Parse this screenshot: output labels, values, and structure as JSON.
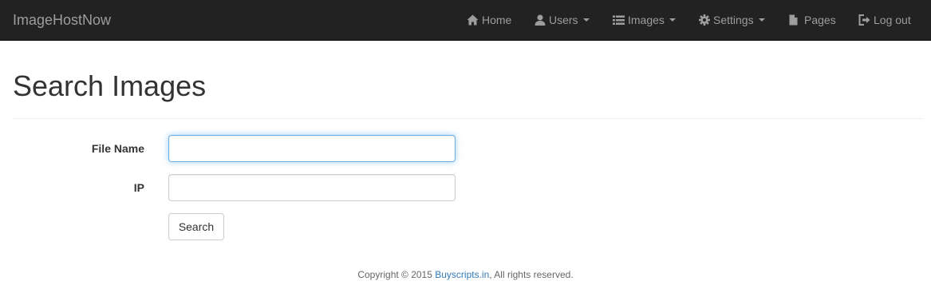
{
  "navbar": {
    "brand": "ImageHostNow",
    "items": [
      {
        "label": "Home",
        "icon": "home-icon",
        "dropdown": false
      },
      {
        "label": "Users",
        "icon": "user-icon",
        "dropdown": true
      },
      {
        "label": "Images",
        "icon": "list-icon",
        "dropdown": true
      },
      {
        "label": "Settings",
        "icon": "gear-icon",
        "dropdown": true
      },
      {
        "label": "Pages",
        "icon": "file-icon",
        "dropdown": false
      },
      {
        "label": "Log out",
        "icon": "logout-icon",
        "dropdown": false
      }
    ]
  },
  "page": {
    "title": "Search Images"
  },
  "form": {
    "file_name_label": "File Name",
    "file_name_value": "",
    "ip_label": "IP",
    "ip_value": "",
    "search_button": "Search"
  },
  "footer": {
    "prefix": "Copyright © 2015 ",
    "link": "Buyscripts.in",
    "suffix": ", All rights reserved."
  },
  "colors": {
    "navbar_bg": "#222222",
    "nav_text": "#9d9d9d",
    "link": "#337ab7",
    "focus_border": "#66afe9"
  }
}
